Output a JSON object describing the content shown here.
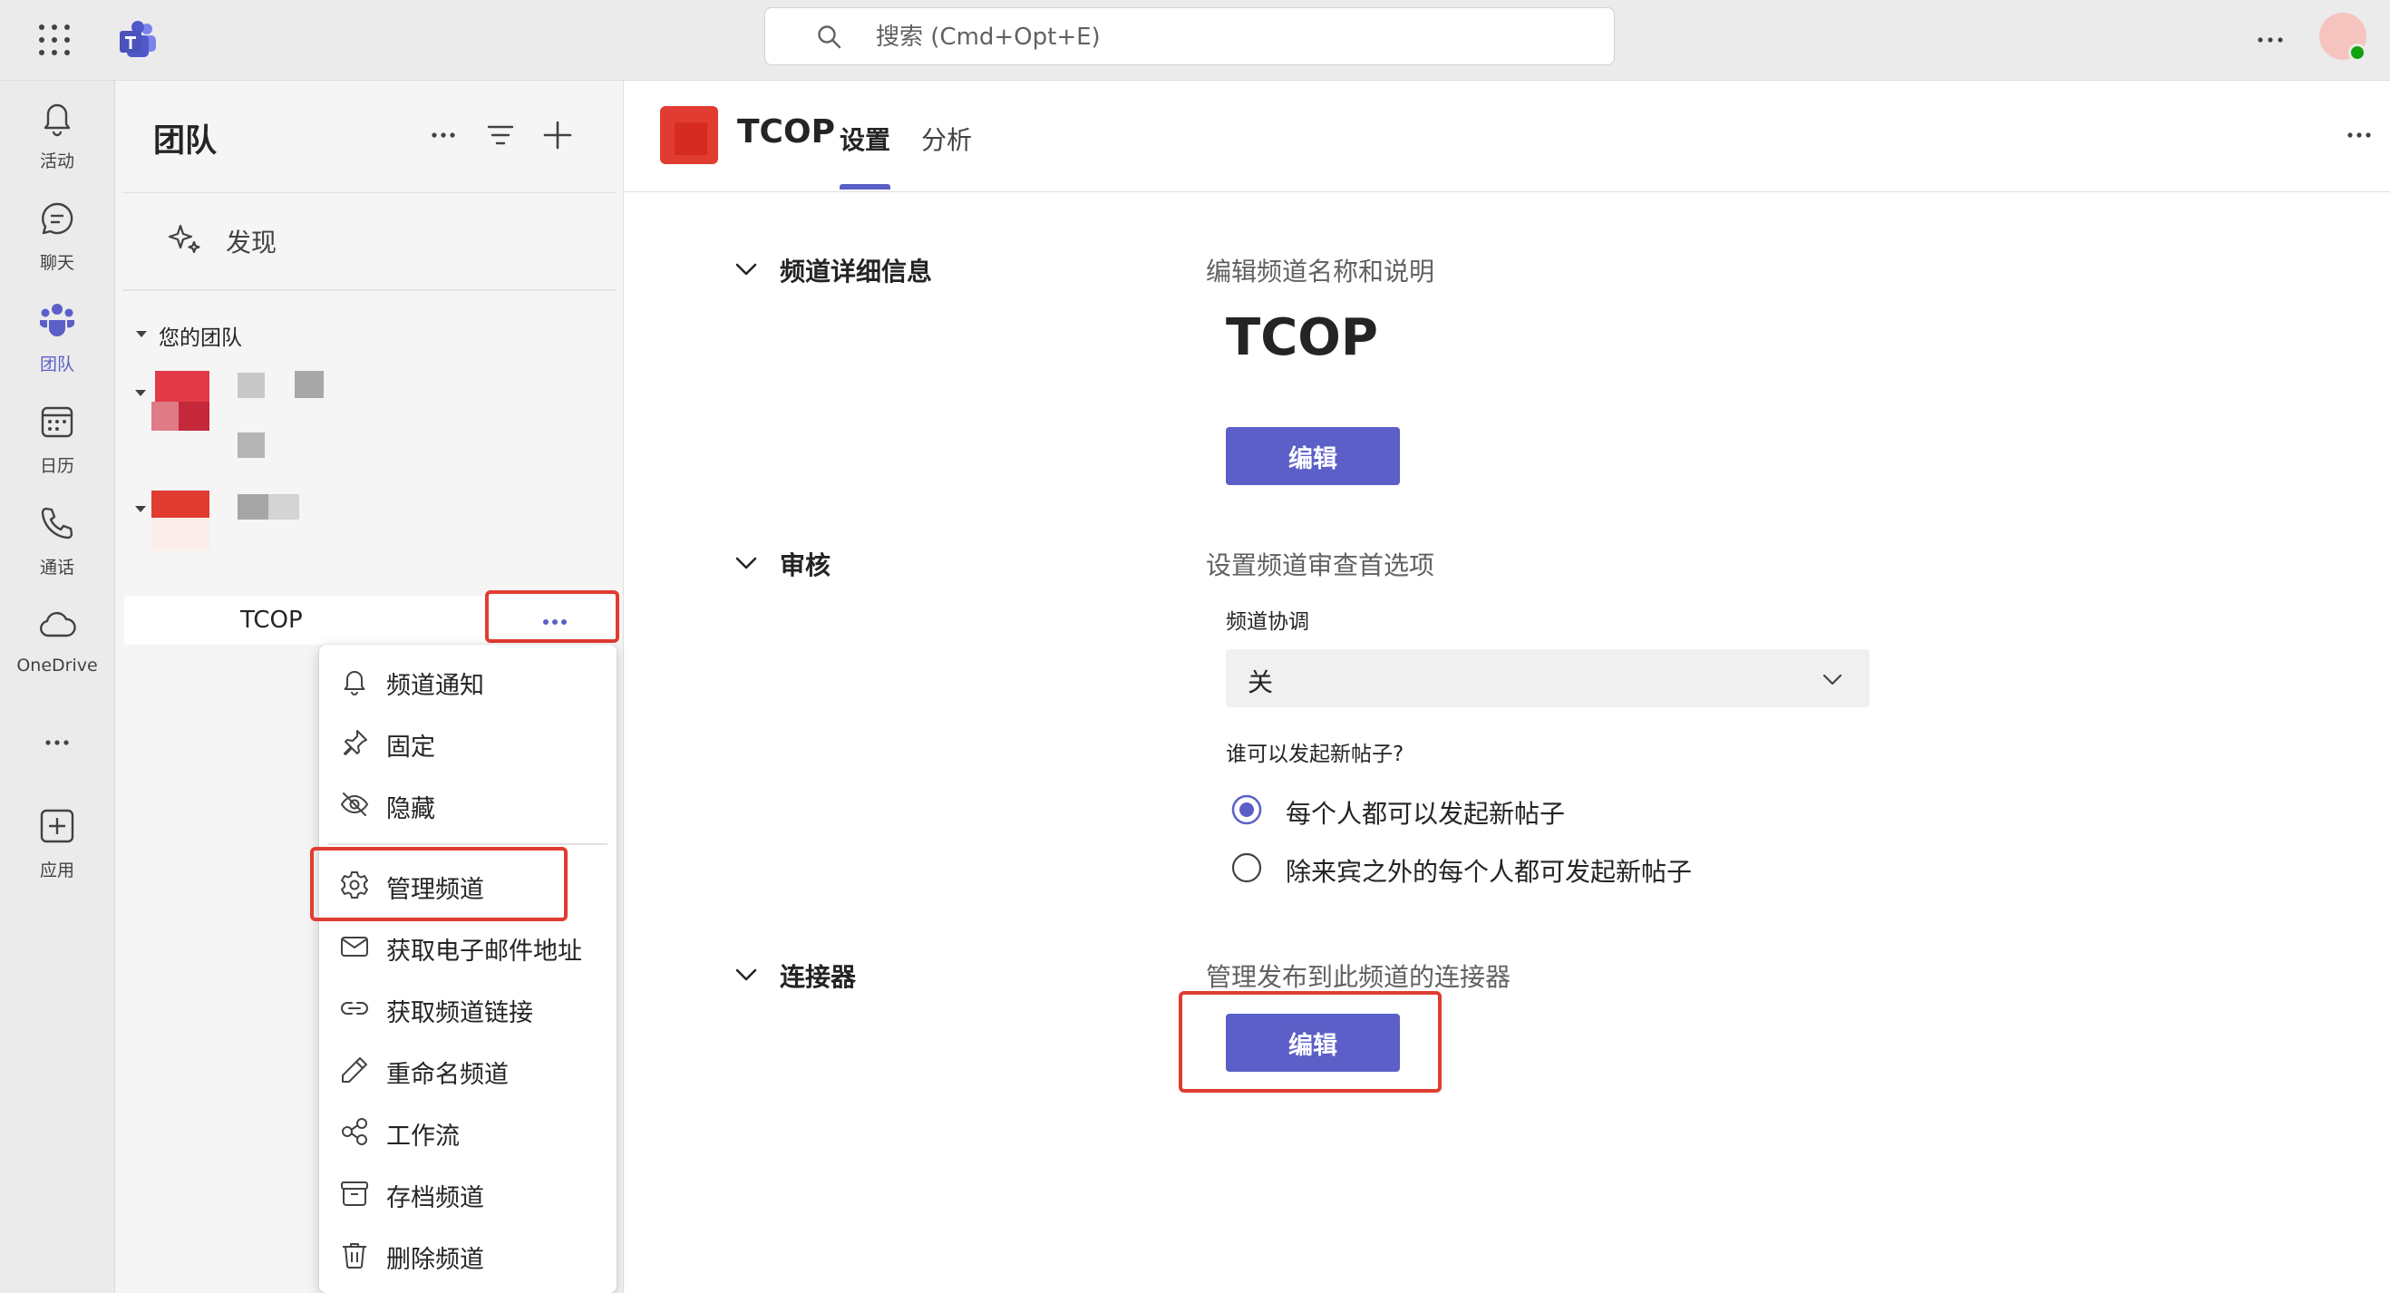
{
  "topbar": {
    "search_placeholder": "搜索 (Cmd+Opt+E)"
  },
  "rail": {
    "items": [
      {
        "label": "活动",
        "icon": "bell-icon"
      },
      {
        "label": "聊天",
        "icon": "chat-icon"
      },
      {
        "label": "团队",
        "icon": "teams-icon",
        "active": true
      },
      {
        "label": "日历",
        "icon": "calendar-icon"
      },
      {
        "label": "通话",
        "icon": "phone-icon"
      },
      {
        "label": "OneDrive",
        "icon": "cloud-icon"
      },
      {
        "label": "应用",
        "icon": "add-app-icon"
      }
    ]
  },
  "pane": {
    "title": "团队",
    "discover_label": "发现",
    "your_teams_label": "您的团队",
    "channel_name": "TCOP"
  },
  "menu": {
    "items": [
      {
        "label": "频道通知",
        "icon": "bell-icon"
      },
      {
        "label": "固定",
        "icon": "pin-icon"
      },
      {
        "label": "隐藏",
        "icon": "eye-off-icon"
      },
      {
        "label": "管理频道",
        "icon": "gear-icon"
      },
      {
        "label": "获取电子邮件地址",
        "icon": "mail-icon"
      },
      {
        "label": "获取频道链接",
        "icon": "link-icon"
      },
      {
        "label": "重命名频道",
        "icon": "pencil-icon"
      },
      {
        "label": "工作流",
        "icon": "workflow-icon"
      },
      {
        "label": "存档频道",
        "icon": "archive-icon"
      },
      {
        "label": "删除频道",
        "icon": "trash-icon"
      }
    ]
  },
  "main": {
    "title": "TCOP",
    "tabs": [
      {
        "label": "设置",
        "active": true
      },
      {
        "label": "分析",
        "active": false
      }
    ]
  },
  "settings": {
    "details": {
      "title": "频道详细信息",
      "description": "编辑频道名称和说明",
      "channel_name": "TCOP",
      "edit_label": "编辑"
    },
    "moderation": {
      "title": "审核",
      "description": "设置频道审查首选项",
      "field_label": "频道协调",
      "select_value": "关",
      "question": "谁可以发起新帖子?",
      "options": [
        {
          "label": "每个人都可以发起新帖子",
          "selected": true
        },
        {
          "label": "除来宾之外的每个人都可发起新帖子",
          "selected": false
        }
      ]
    },
    "connectors": {
      "title": "连接器",
      "description": "管理发布到此频道的连接器",
      "edit_label": "编辑"
    }
  },
  "colors": {
    "accent": "#5b5fc7",
    "highlight": "#e03c31",
    "rail_bg": "#ebebeb",
    "pane_bg": "#f5f5f5"
  }
}
